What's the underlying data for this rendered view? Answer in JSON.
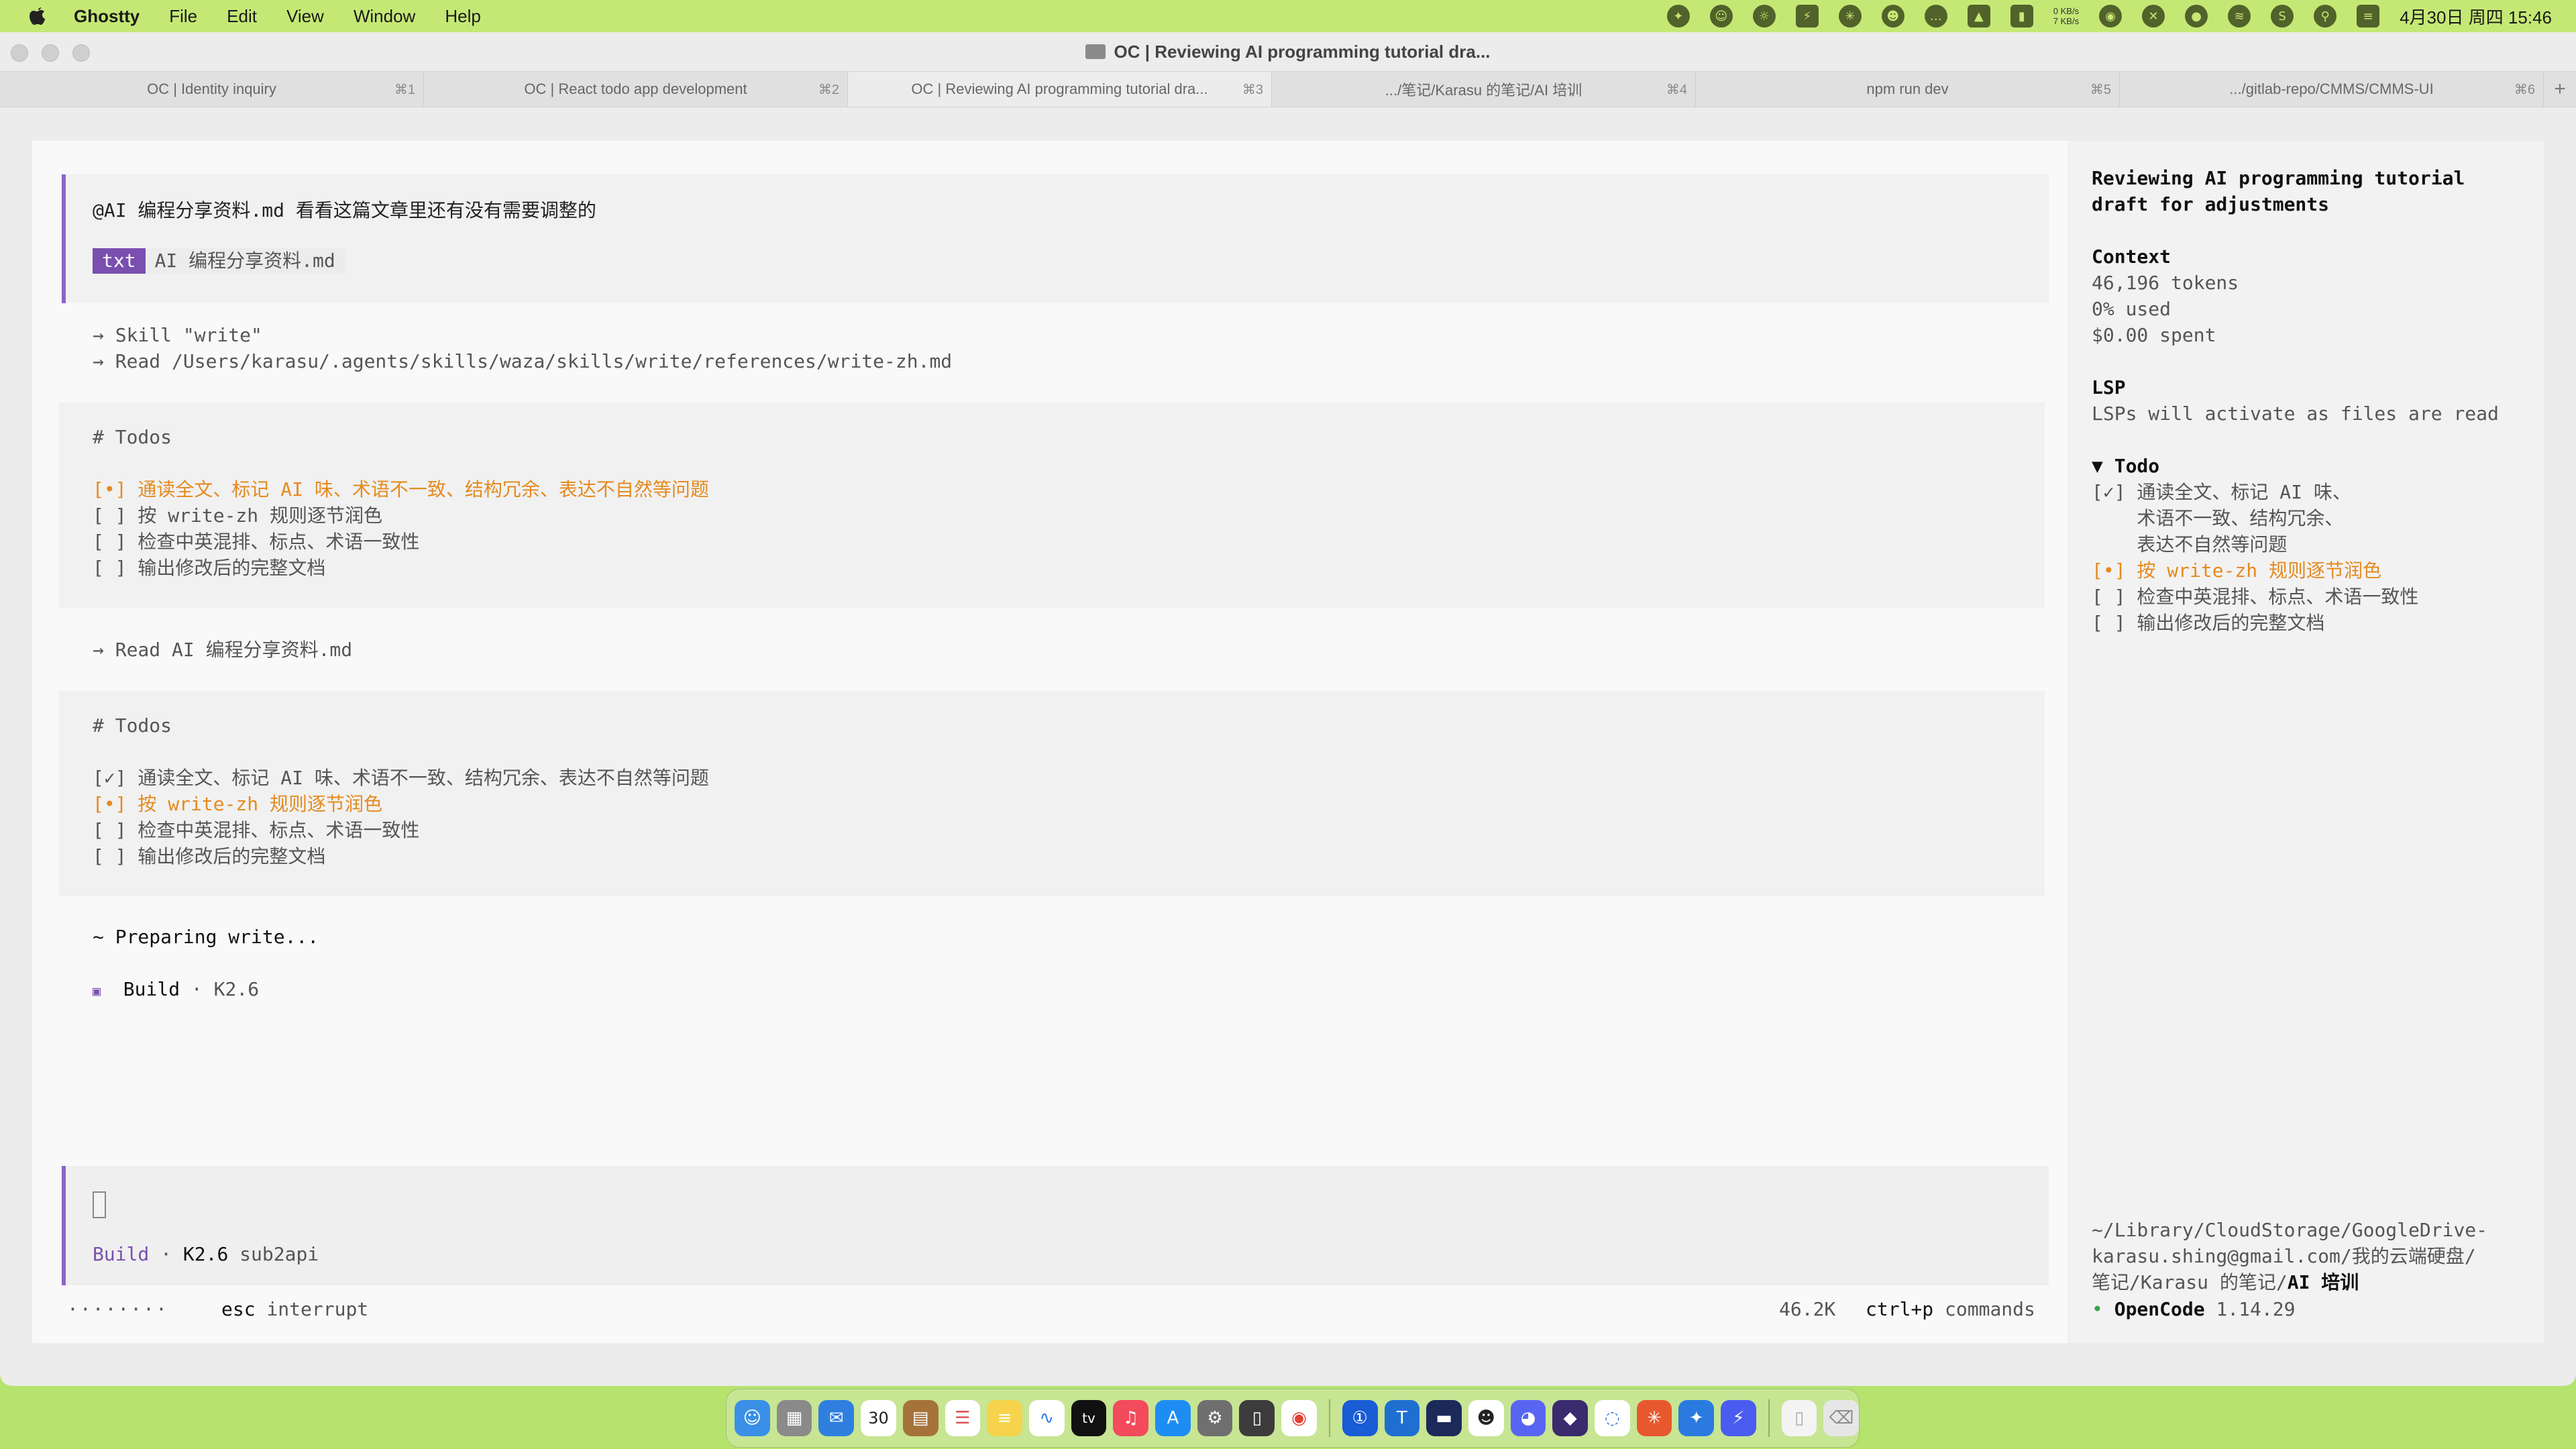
{
  "menubar": {
    "app_name": "Ghostty",
    "items": [
      "File",
      "Edit",
      "View",
      "Window",
      "Help"
    ],
    "net_up": "0 KB/s",
    "net_down": "7 KB/s",
    "datetime": "4月30日 周四  15:46"
  },
  "window": {
    "title": "OC | Reviewing AI programming tutorial dra..."
  },
  "tabs": [
    {
      "label": "OC | Identity inquiry",
      "shortcut": "⌘1"
    },
    {
      "label": "OC | React todo app development",
      "shortcut": "⌘2"
    },
    {
      "label": "OC | Reviewing AI programming tutorial dra...",
      "shortcut": "⌘3"
    },
    {
      "label": ".../笔记/Karasu 的笔记/AI 培训",
      "shortcut": "⌘4"
    },
    {
      "label": "npm run dev",
      "shortcut": "⌘5"
    },
    {
      "label": ".../gitlab-repo/CMMS/CMMS-UI",
      "shortcut": "⌘6"
    }
  ],
  "conversation": {
    "user_message": "@AI 编程分享资料.md 看看这篇文章里还有没有需要调整的",
    "attachment_type": "txt",
    "attachment_name": "AI 编程分享资料.md",
    "tool_call_1": "→ Skill \"write\"",
    "tool_call_2": "→ Read /Users/karasu/.agents/skills/waza/skills/write/references/write-zh.md",
    "todos_1_heading": "# Todos",
    "todos_1": [
      "[•] 通读全文、标记 AI 味、术语不一致、结构冗余、表达不自然等问题",
      "[ ] 按 write-zh 规则逐节润色",
      "[ ] 检查中英混排、标点、术语一致性",
      "[ ] 输出修改后的完整文档"
    ],
    "read_call": "→ Read AI 编程分享资料.md",
    "todos_2_heading": "# Todos",
    "todos_2": [
      "[✓] 通读全文、标记 AI 味、术语不一致、结构冗余、表达不自然等问题",
      "[•] 按 write-zh 规则逐节润色",
      "[ ] 检查中英混排、标点、术语一致性",
      "[ ] 输出修改后的完整文档"
    ],
    "preparing": "~ Preparing write...",
    "build_marker": "▣",
    "build_label": "Build",
    "build_model": "· K2.6"
  },
  "input": {
    "mode": "Build",
    "model": "K2.6",
    "provider": "sub2api"
  },
  "statusbar": {
    "spinner": "········",
    "key": "esc",
    "key_action": "interrupt",
    "tokens": "46.2K",
    "cmd_key": "ctrl+p",
    "cmd_action": "commands"
  },
  "sidebar": {
    "title_line1": "Reviewing AI programming tutorial",
    "title_line2": "draft for adjustments",
    "context_heading": "Context",
    "context_tokens": "46,196 tokens",
    "context_used": "0% used",
    "context_spent": "$0.00 spent",
    "lsp_heading": "LSP",
    "lsp_text": "LSPs will activate as files are read",
    "todo_heading": "▼ Todo",
    "todo_lines": [
      "[✓] 通读全文、标记 AI 味、",
      "    术语不一致、结构冗余、",
      "    表达不自然等问题"
    ],
    "todo_active": "[•] 按 write-zh 规则逐节润色",
    "todo_rest": [
      "[ ] 检查中英混排、标点、术语一致性",
      "[ ] 输出修改后的完整文档"
    ],
    "path_line1": "~/Library/CloudStorage/GoogleDrive-",
    "path_line2": "karasu.shing@gmail.com/我的云端硬盘/",
    "path_line3_prefix": "笔记/Karasu 的笔记/",
    "path_line3_bold": "AI 培训",
    "app_dot": "•",
    "app_name": "OpenCode",
    "app_version": "1.14.29"
  },
  "dock": {
    "calendar_day": "30",
    "icons": [
      "finder-icon",
      "launchpad-icon",
      "mail-icon",
      "calendar-icon",
      "notes-brown-icon",
      "reminders-icon",
      "notes-icon",
      "freeform-icon",
      "appletv-icon",
      "music-icon",
      "appstore-icon",
      "settings-icon",
      "iphone-mirroring-icon",
      "chrome-icon",
      "1password-icon",
      "teams-icon",
      "terminal-icon",
      "panda-icon",
      "discord-icon",
      "obsidian-icon",
      "chat-icon",
      "claude-icon",
      "safari-icon",
      "shortcuts-icon",
      "document-icon",
      "trash-icon"
    ]
  },
  "colors": {
    "accent_purple": "#7a4fb0",
    "todo_active_orange": "#e58a1f",
    "desktop_green": "#b5e36d"
  }
}
